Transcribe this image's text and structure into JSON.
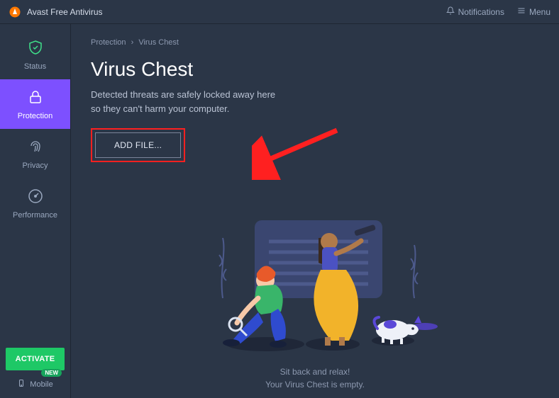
{
  "titlebar": {
    "app_name": "Avast Free Antivirus",
    "notifications_label": "Notifications",
    "menu_label": "Menu"
  },
  "sidebar": {
    "items": [
      {
        "label": "Status"
      },
      {
        "label": "Protection"
      },
      {
        "label": "Privacy"
      },
      {
        "label": "Performance"
      }
    ],
    "activate_label": "ACTIVATE",
    "mobile_label": "Mobile",
    "new_badge": "NEW"
  },
  "breadcrumb": {
    "root": "Protection",
    "current": "Virus Chest"
  },
  "page": {
    "title": "Virus Chest",
    "subtitle_line1": "Detected threats are safely locked away here",
    "subtitle_line2": "so they can't harm your computer.",
    "add_file_label": "ADD FILE..."
  },
  "empty_state": {
    "line1": "Sit back and relax!",
    "line2": "Your Virus Chest is empty."
  },
  "colors": {
    "accent": "#7d50ff",
    "activate": "#1ec866",
    "annotation": "#ff2020"
  }
}
